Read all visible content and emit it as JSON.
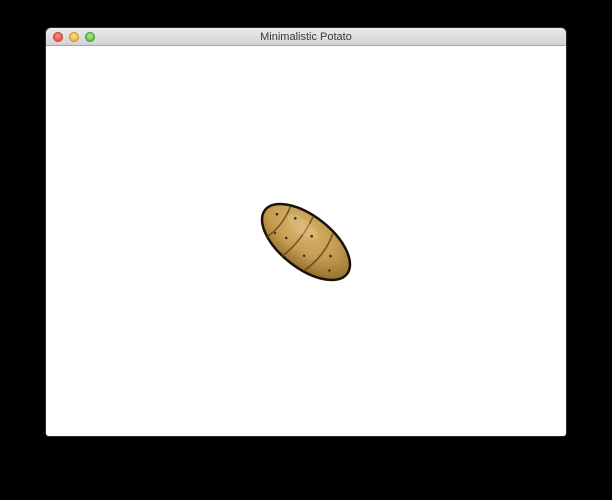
{
  "window": {
    "title": "Minimalistic Potato"
  },
  "colors": {
    "background": "#000000",
    "window": "#ffffff",
    "potato_skin": "#c9a45a",
    "potato_outline": "#1a1208"
  },
  "icons": {
    "close": "close-icon",
    "minimize": "minimize-icon",
    "zoom": "zoom-icon",
    "content": "potato-icon"
  }
}
